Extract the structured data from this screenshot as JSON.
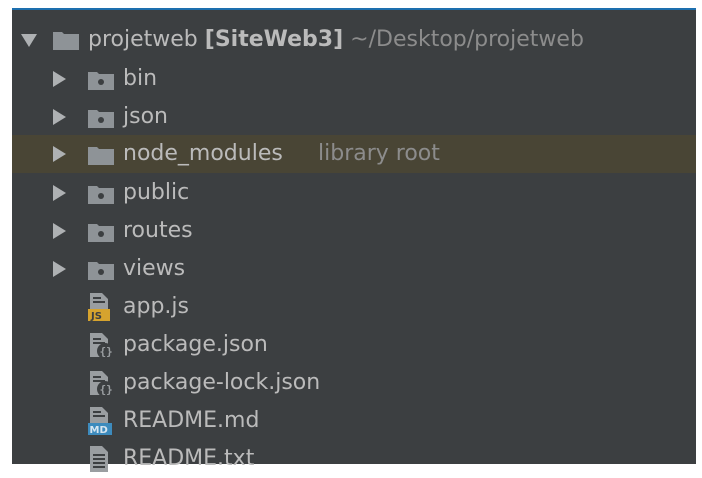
{
  "tree": {
    "root": {
      "name": "projetweb",
      "module": "[SiteWeb3]",
      "path": "~/Desktop/projetweb"
    },
    "folders": [
      {
        "name": "bin"
      },
      {
        "name": "json"
      },
      {
        "name": "node_modules",
        "note": "library root"
      },
      {
        "name": "public"
      },
      {
        "name": "routes"
      },
      {
        "name": "views"
      }
    ],
    "files": [
      {
        "name": "app.js",
        "icon": "js-file-icon",
        "badge": "JS"
      },
      {
        "name": "package.json",
        "icon": "json-file-icon"
      },
      {
        "name": "package-lock.json",
        "icon": "json-file-icon"
      },
      {
        "name": "README.md",
        "icon": "markdown-file-icon",
        "badge": "MD"
      },
      {
        "name": "README.txt",
        "icon": "text-file-icon"
      }
    ]
  },
  "colors": {
    "panel_bg": "#3c3f41",
    "highlight_bg": "#494535",
    "text": "#bbbbbb",
    "dim_text": "#8c8c8c",
    "folder": "#8e9397",
    "js_badge": "#d6a32e",
    "md_badge": "#3d8bbd"
  }
}
